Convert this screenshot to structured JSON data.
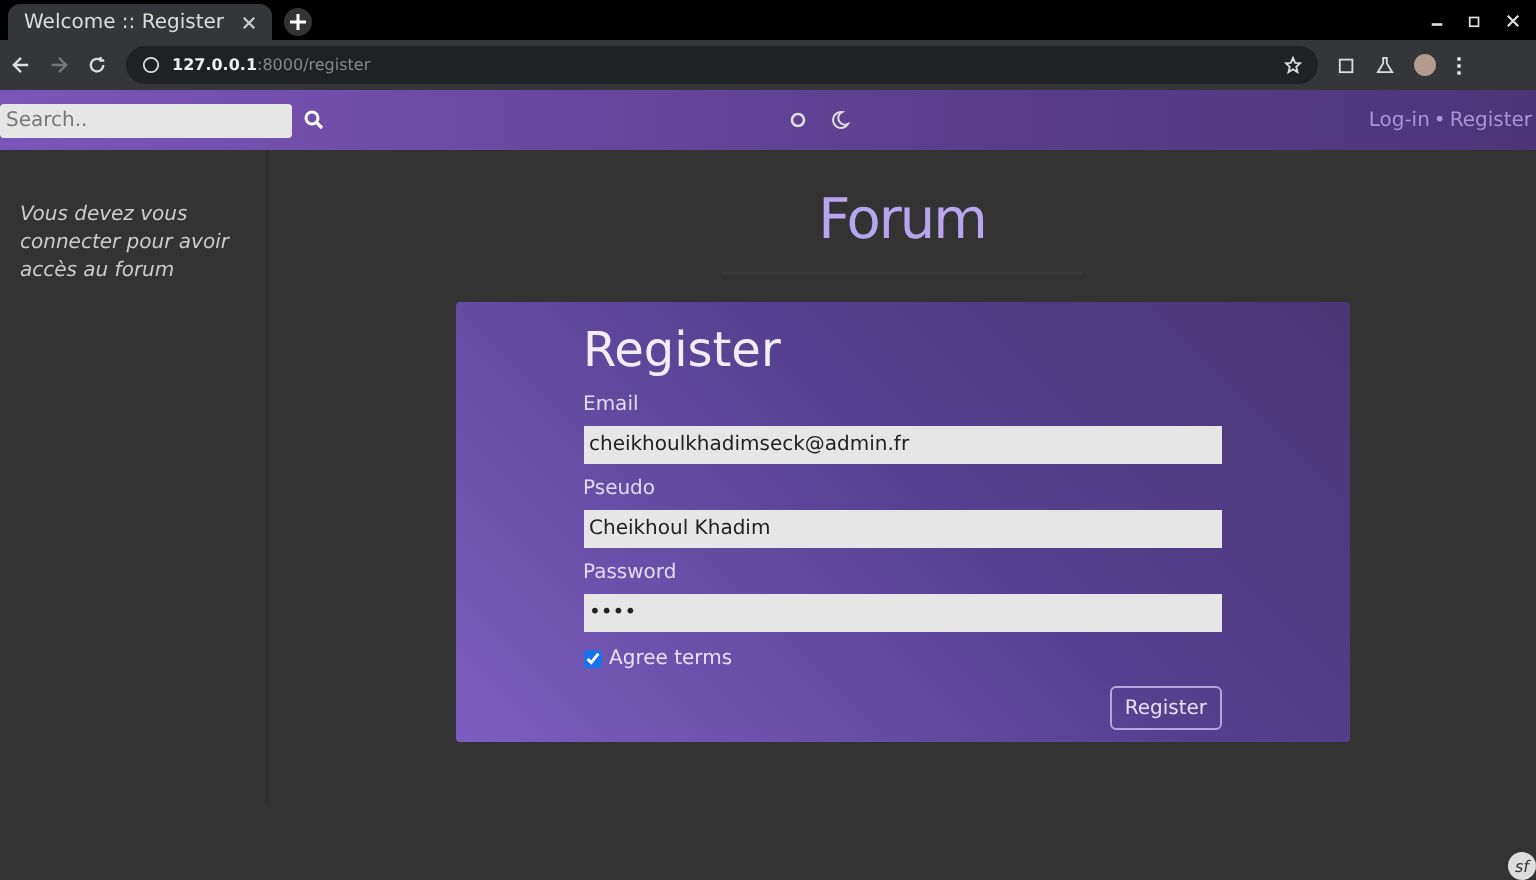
{
  "browser": {
    "tab_title": "Welcome :: Register",
    "url_host": "127.0.0.1",
    "url_path": ":8000/register"
  },
  "navbar": {
    "search": {
      "placeholder": "Search.."
    },
    "links": [
      "Log-in",
      "Register"
    ],
    "separator": "•"
  },
  "sidebar": {
    "message": "Vous devez vous connecter pour avoir accès au forum"
  },
  "logo": "Forum",
  "form": {
    "title": "Register",
    "fields": [
      {
        "label": "Email",
        "value": "cheikhoulkhadimseck@admin.fr"
      },
      {
        "label": "Pseudo",
        "value": "Cheikhoul Khadim"
      },
      {
        "label": "Password",
        "value": "••••"
      }
    ],
    "agree": {
      "label": "Agree terms",
      "checked": true
    },
    "submit": "Register"
  },
  "debug_badge": "sf"
}
